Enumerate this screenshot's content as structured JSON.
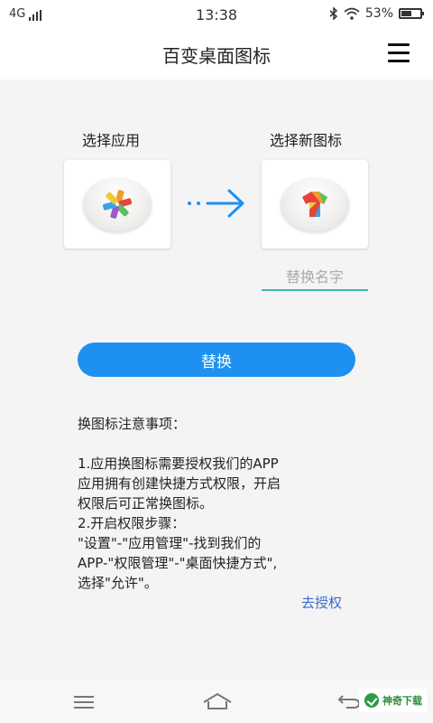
{
  "status_bar": {
    "network": "4G",
    "time": "13:38",
    "battery": "53%",
    "battery_level": 0.53
  },
  "header": {
    "title": "百变桌面图标"
  },
  "main": {
    "select_app_label": "选择应用",
    "select_icon_label": "选择新图标",
    "name_placeholder": "替换名字",
    "replace_button": "替换"
  },
  "notes": {
    "heading": "换图标注意事项：",
    "lines": [
      "1.应用换图标需要授权我们的APP",
      "应用拥有创建快捷方式权限，开启",
      "权限后可正常换图标。",
      "2.开启权限步骤：",
      "\"设置\"-\"应用管理\"-找到我们的",
      "APP-\"权限管理\"-\"桌面快捷方式\",",
      "选择\"允许\"。"
    ],
    "authorize_link": "去授权"
  },
  "nav_bar": {
    "watermark_text": "神奇下载"
  },
  "colors": {
    "primary_button": "#1e90f0",
    "arrow": "#1e90f0",
    "link": "#3a6bc8",
    "input_underline": "#39b5b0"
  }
}
